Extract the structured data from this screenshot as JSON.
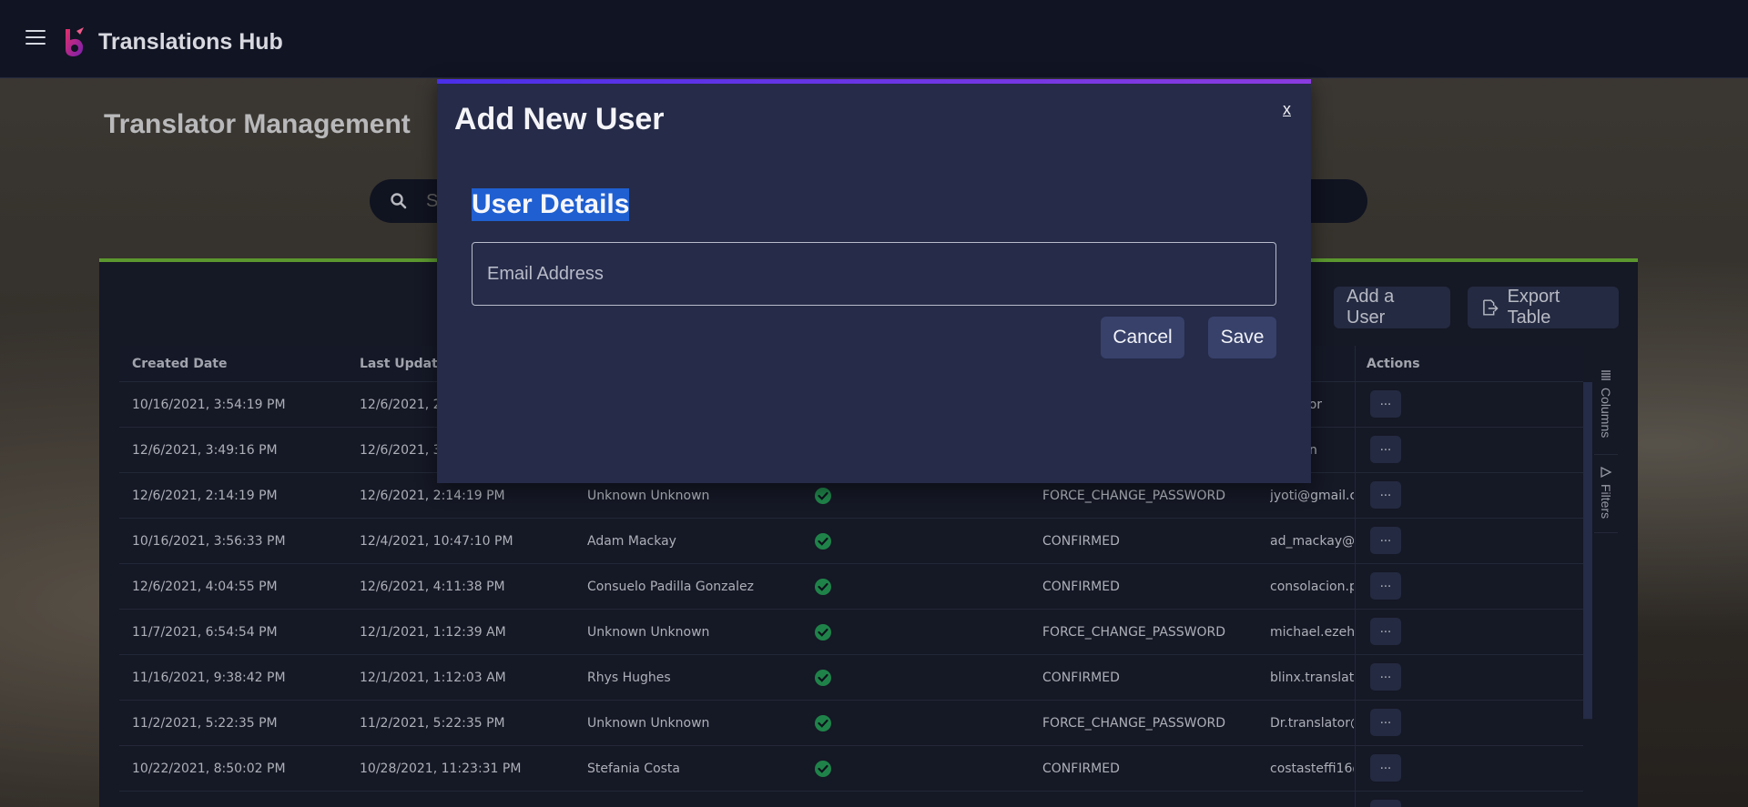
{
  "app": {
    "title": "Translations Hub",
    "accent": "#6a3df0",
    "header_bg": "#111423"
  },
  "page": {
    "title": "Translator Management"
  },
  "search": {
    "placeholder": "S"
  },
  "toolbar": {
    "add_user_label": "Add a User",
    "export_label": "Export Table"
  },
  "grid": {
    "headers": [
      "Created Date",
      "Last Update",
      "",
      "",
      "",
      "",
      "Actions"
    ],
    "rows": [
      {
        "created": "10/16/2021, 3:54:19 PM",
        "updated": "12/6/2021, 2",
        "name": "",
        "status": "",
        "email": "anslator"
      },
      {
        "created": "12/6/2021, 3:49:16 PM",
        "updated": "12/6/2021, 3",
        "name": "",
        "status": "",
        "email": "ew@gn"
      },
      {
        "created": "12/6/2021, 2:14:19 PM",
        "updated": "12/6/2021, 2:14:19 PM",
        "name": "Unknown Unknown",
        "status": "FORCE_CHANGE_PASSWORD",
        "email": "jyoti@gmail.co"
      },
      {
        "created": "10/16/2021, 3:56:33 PM",
        "updated": "12/4/2021, 10:47:10 PM",
        "name": "Adam Mackay",
        "status": "CONFIRMED",
        "email": "ad_mackay@y"
      },
      {
        "created": "12/6/2021, 4:04:55 PM",
        "updated": "12/6/2021, 4:11:38 PM",
        "name": "Consuelo Padilla Gonzalez",
        "status": "CONFIRMED",
        "email": "consolacion.pa"
      },
      {
        "created": "11/7/2021, 6:54:54 PM",
        "updated": "12/1/2021, 1:12:39 AM",
        "name": "Unknown Unknown",
        "status": "FORCE_CHANGE_PASSWORD",
        "email": "michael.ezehi"
      },
      {
        "created": "11/16/2021, 9:38:42 PM",
        "updated": "12/1/2021, 1:12:03 AM",
        "name": "Rhys Hughes",
        "status": "CONFIRMED",
        "email": "blinx.translato"
      },
      {
        "created": "11/2/2021, 5:22:35 PM",
        "updated": "11/2/2021, 5:22:35 PM",
        "name": "Unknown Unknown",
        "status": "FORCE_CHANGE_PASSWORD",
        "email": "Dr.translator@"
      },
      {
        "created": "10/22/2021, 8:50:02 PM",
        "updated": "10/28/2021, 11:23:31 PM",
        "name": "Stefania Costa",
        "status": "CONFIRMED",
        "email": "costasteffi16@"
      }
    ],
    "actions_label": "...",
    "side_tabs": {
      "columns": "Columns",
      "filters": "Filters"
    }
  },
  "modal": {
    "title": "Add New User",
    "close_label": "x",
    "section_title": "User Details",
    "email_placeholder": "Email Address",
    "email_value": "",
    "cancel_label": "Cancel",
    "save_label": "Save"
  }
}
